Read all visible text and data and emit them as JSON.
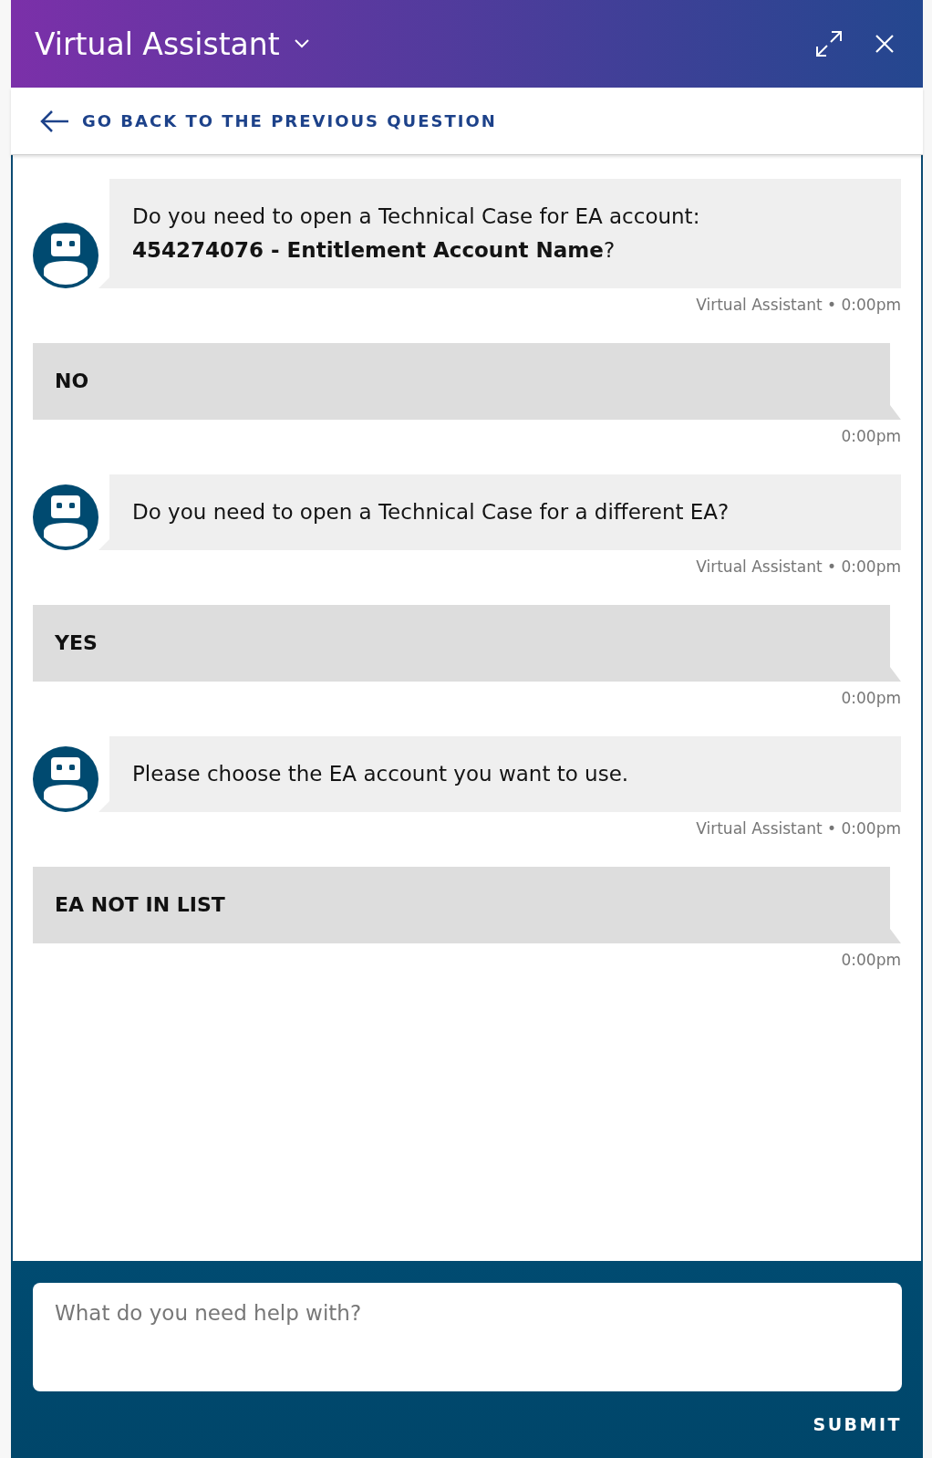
{
  "header": {
    "title": "Virtual Assistant"
  },
  "back_link": {
    "label": "GO BACK TO THE PREVIOUS QUESTION"
  },
  "messages": [
    {
      "kind": "bot",
      "text": "Do you need to open a Technical Case for EA account:\n**454274076 - Entitlement Account Name**?",
      "meta": "Virtual Assistant • 0:00pm"
    },
    {
      "kind": "user",
      "text": "NO",
      "meta": "0:00pm"
    },
    {
      "kind": "bot",
      "text": "Do you need to open a Technical Case for a different EA?",
      "meta": "Virtual Assistant • 0:00pm"
    },
    {
      "kind": "user",
      "text": "YES",
      "meta": "0:00pm"
    },
    {
      "kind": "bot",
      "text": "Please choose the EA account you want to use.",
      "meta": "Virtual Assistant • 0:00pm"
    },
    {
      "kind": "user",
      "text": "EA NOT IN LIST",
      "meta": "0:00pm"
    }
  ],
  "composer": {
    "placeholder": "What do you need help with?",
    "submit": "SUBMIT"
  }
}
